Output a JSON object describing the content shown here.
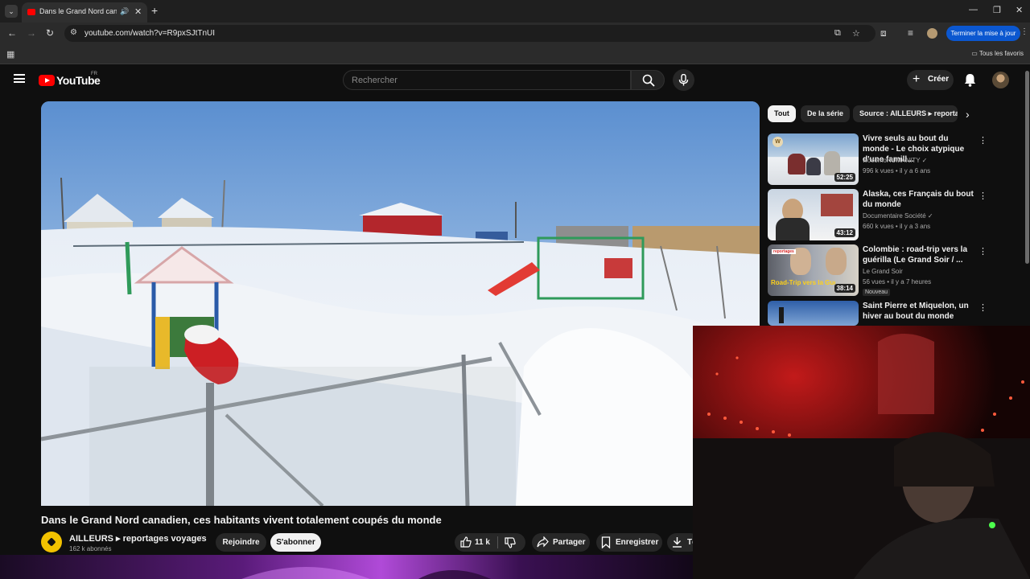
{
  "browser": {
    "tab_title": "Dans le Grand Nord canadien",
    "url": "youtube.com/watch?v=R9pxSJtTnUI",
    "update_button": "Terminer la mise à jour",
    "bookmarks_all": "Tous les favoris"
  },
  "youtube": {
    "logo_text": "YouTube",
    "country_code": "FR",
    "search_placeholder": "Rechercher",
    "create_label": "Créer"
  },
  "video": {
    "title": "Dans le Grand Nord canadien, ces habitants vivent totalement coupés du monde",
    "channel_name": "AILLEURS ▸ reportages voyages",
    "subscribers": "162 k abonnés",
    "join_label": "Rejoindre",
    "subscribe_label": "S'abonner",
    "like_count": "11 k",
    "share_label": "Partager",
    "save_label": "Enregistrer",
    "download_label": "Té"
  },
  "sidebar": {
    "chips": [
      "Tout",
      "De la série",
      "Source : AILLEURS ▸ reportages"
    ],
    "recommendations": [
      {
        "title": "Vivre seuls au bout du monde - Le choix atypique d'une famill...",
        "channel": "wocomoHUMANITY ✓",
        "meta": "996 k vues • il y a 6 ans",
        "duration": "52:25",
        "badge": ""
      },
      {
        "title": "Alaska, ces Français du bout du monde",
        "channel": "Documentaire Société ✓",
        "meta": "660 k vues • il y a 3 ans",
        "duration": "43:12",
        "badge": ""
      },
      {
        "title": "Colombie : road-trip vers la guérilla (Le Grand Soir / ...",
        "channel": "Le Grand Soir",
        "meta": "56 vues • il y a 7 heures",
        "duration": "38:14",
        "badge": "Nouveau",
        "thumb_text_top": "reportages",
        "thumb_text": "Road-Trip vers la Guérilla"
      },
      {
        "title": "Saint Pierre et Miquelon, un hiver au bout du monde",
        "channel": "",
        "meta": "",
        "duration": "",
        "badge": ""
      }
    ]
  },
  "icons": {
    "menu": "hamburger-icon",
    "search": "search-icon",
    "mic": "mic-icon",
    "bell": "bell-icon",
    "like": "thumb-up-icon",
    "dislike": "thumb-down-icon",
    "share": "share-icon",
    "save": "bookmark-icon",
    "download": "download-icon"
  },
  "colors": {
    "yt_red": "#ff0000",
    "background": "#0f0f0f",
    "update_blue": "#0b57d0"
  }
}
